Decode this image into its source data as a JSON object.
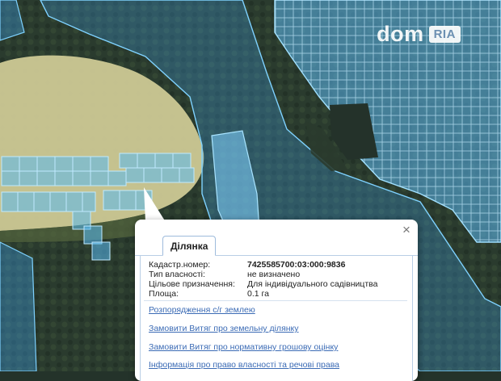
{
  "logo": {
    "brand": "dom",
    "badge": "RIA"
  },
  "popup": {
    "tab_label": "Ділянка",
    "close_glyph": "×",
    "fields": [
      {
        "label": "Кадастр.номер:",
        "value": "7425585700:03:000:9836",
        "emphasis": true
      },
      {
        "label": "Тип власності:",
        "value": "не визначено",
        "emphasis": false
      },
      {
        "label": "Цільове призначення:",
        "value": "Для індивідуального садівництва",
        "emphasis": false
      },
      {
        "label": "Площа:",
        "value": "0.1 га",
        "emphasis": false
      }
    ],
    "links": [
      "Розпорядження с/г землею",
      "Замовити Витяг про земельну ділянку",
      "Замовити Витяг про нормативну грошову оцінку",
      "Інформація про право власності та речові права"
    ]
  },
  "colors": {
    "parcel_fill": "#3fa9f5",
    "parcel_stroke": "#7fd2ff",
    "field": "#c9c993",
    "forest": "#2c3d2f",
    "link": "#3b6bb5"
  }
}
